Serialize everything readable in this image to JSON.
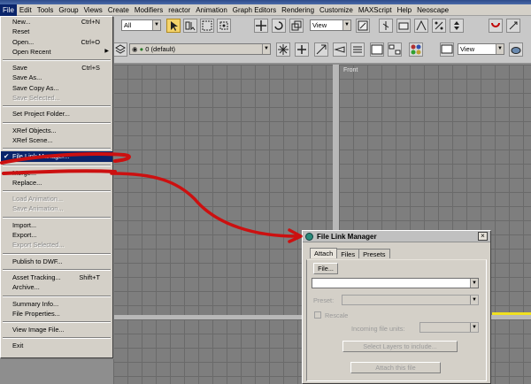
{
  "menubar": {
    "items": [
      "File",
      "Edit",
      "Tools",
      "Group",
      "Views",
      "Create",
      "Modifiers",
      "reactor",
      "Animation",
      "Graph Editors",
      "Rendering",
      "Customize",
      "MAXScript",
      "Help",
      "Neoscape"
    ]
  },
  "toolbar": {
    "selection_filter": "All",
    "coord_left": "View",
    "coord_right": "View",
    "layer": "0 (default)"
  },
  "viewports": {
    "front_label": "Front"
  },
  "file_menu": {
    "items": [
      {
        "label": "New...",
        "shortcut": "Ctrl+N",
        "disabled": false
      },
      {
        "label": "Reset",
        "shortcut": "",
        "disabled": false
      },
      {
        "label": "Open...",
        "shortcut": "Ctrl+O",
        "disabled": false
      },
      {
        "label": "Open Recent",
        "shortcut": "",
        "disabled": false,
        "submenu": true
      },
      {
        "sep": true
      },
      {
        "label": "Save",
        "shortcut": "Ctrl+S",
        "disabled": false
      },
      {
        "label": "Save As...",
        "shortcut": "",
        "disabled": false
      },
      {
        "label": "Save Copy As...",
        "shortcut": "",
        "disabled": false
      },
      {
        "label": "Save Selected...",
        "shortcut": "",
        "disabled": true
      },
      {
        "sep": true
      },
      {
        "label": "Set Project Folder...",
        "shortcut": "",
        "disabled": false
      },
      {
        "sep": true
      },
      {
        "label": "XRef Objects...",
        "shortcut": "",
        "disabled": false
      },
      {
        "label": "XRef Scene...",
        "shortcut": "",
        "disabled": false
      },
      {
        "sep": true
      },
      {
        "label": "File Link Manager...",
        "shortcut": "",
        "disabled": false,
        "checked": true,
        "highlighted": true
      },
      {
        "sep": true
      },
      {
        "label": "Merge...",
        "shortcut": "",
        "disabled": false
      },
      {
        "label": "Replace...",
        "shortcut": "",
        "disabled": false
      },
      {
        "sep": true
      },
      {
        "label": "Load Animation...",
        "shortcut": "",
        "disabled": true
      },
      {
        "label": "Save Animation...",
        "shortcut": "",
        "disabled": true
      },
      {
        "sep": true
      },
      {
        "label": "Import...",
        "shortcut": "",
        "disabled": false
      },
      {
        "label": "Export...",
        "shortcut": "",
        "disabled": false
      },
      {
        "label": "Export Selected...",
        "shortcut": "",
        "disabled": true
      },
      {
        "sep": true
      },
      {
        "label": "Publish to DWF...",
        "shortcut": "",
        "disabled": false
      },
      {
        "sep": true
      },
      {
        "label": "Asset Tracking...",
        "shortcut": "Shift+T",
        "disabled": false
      },
      {
        "label": "Archive...",
        "shortcut": "",
        "disabled": false
      },
      {
        "sep": true
      },
      {
        "label": "Summary Info...",
        "shortcut": "",
        "disabled": false
      },
      {
        "label": "File Properties...",
        "shortcut": "",
        "disabled": false
      },
      {
        "sep": true
      },
      {
        "label": "View Image File...",
        "shortcut": "",
        "disabled": false
      },
      {
        "sep": true
      },
      {
        "label": "Exit",
        "shortcut": "",
        "disabled": false
      }
    ]
  },
  "dialog": {
    "title": "File Link Manager",
    "close": "×",
    "tabs": [
      "Attach",
      "Files",
      "Presets"
    ],
    "file_button": "File...",
    "file_path": "",
    "preset_label": "Preset:",
    "preset_value": "",
    "rescale_label": "Rescale",
    "units_label": "Incoming file units:",
    "units_value": "",
    "select_layers_button": "Select Layers to include...",
    "attach_button": "Attach this file"
  },
  "colors": {
    "annotation": "#cc1010",
    "highlight": "#0a246a",
    "ui_face": "#d4d0c8"
  }
}
